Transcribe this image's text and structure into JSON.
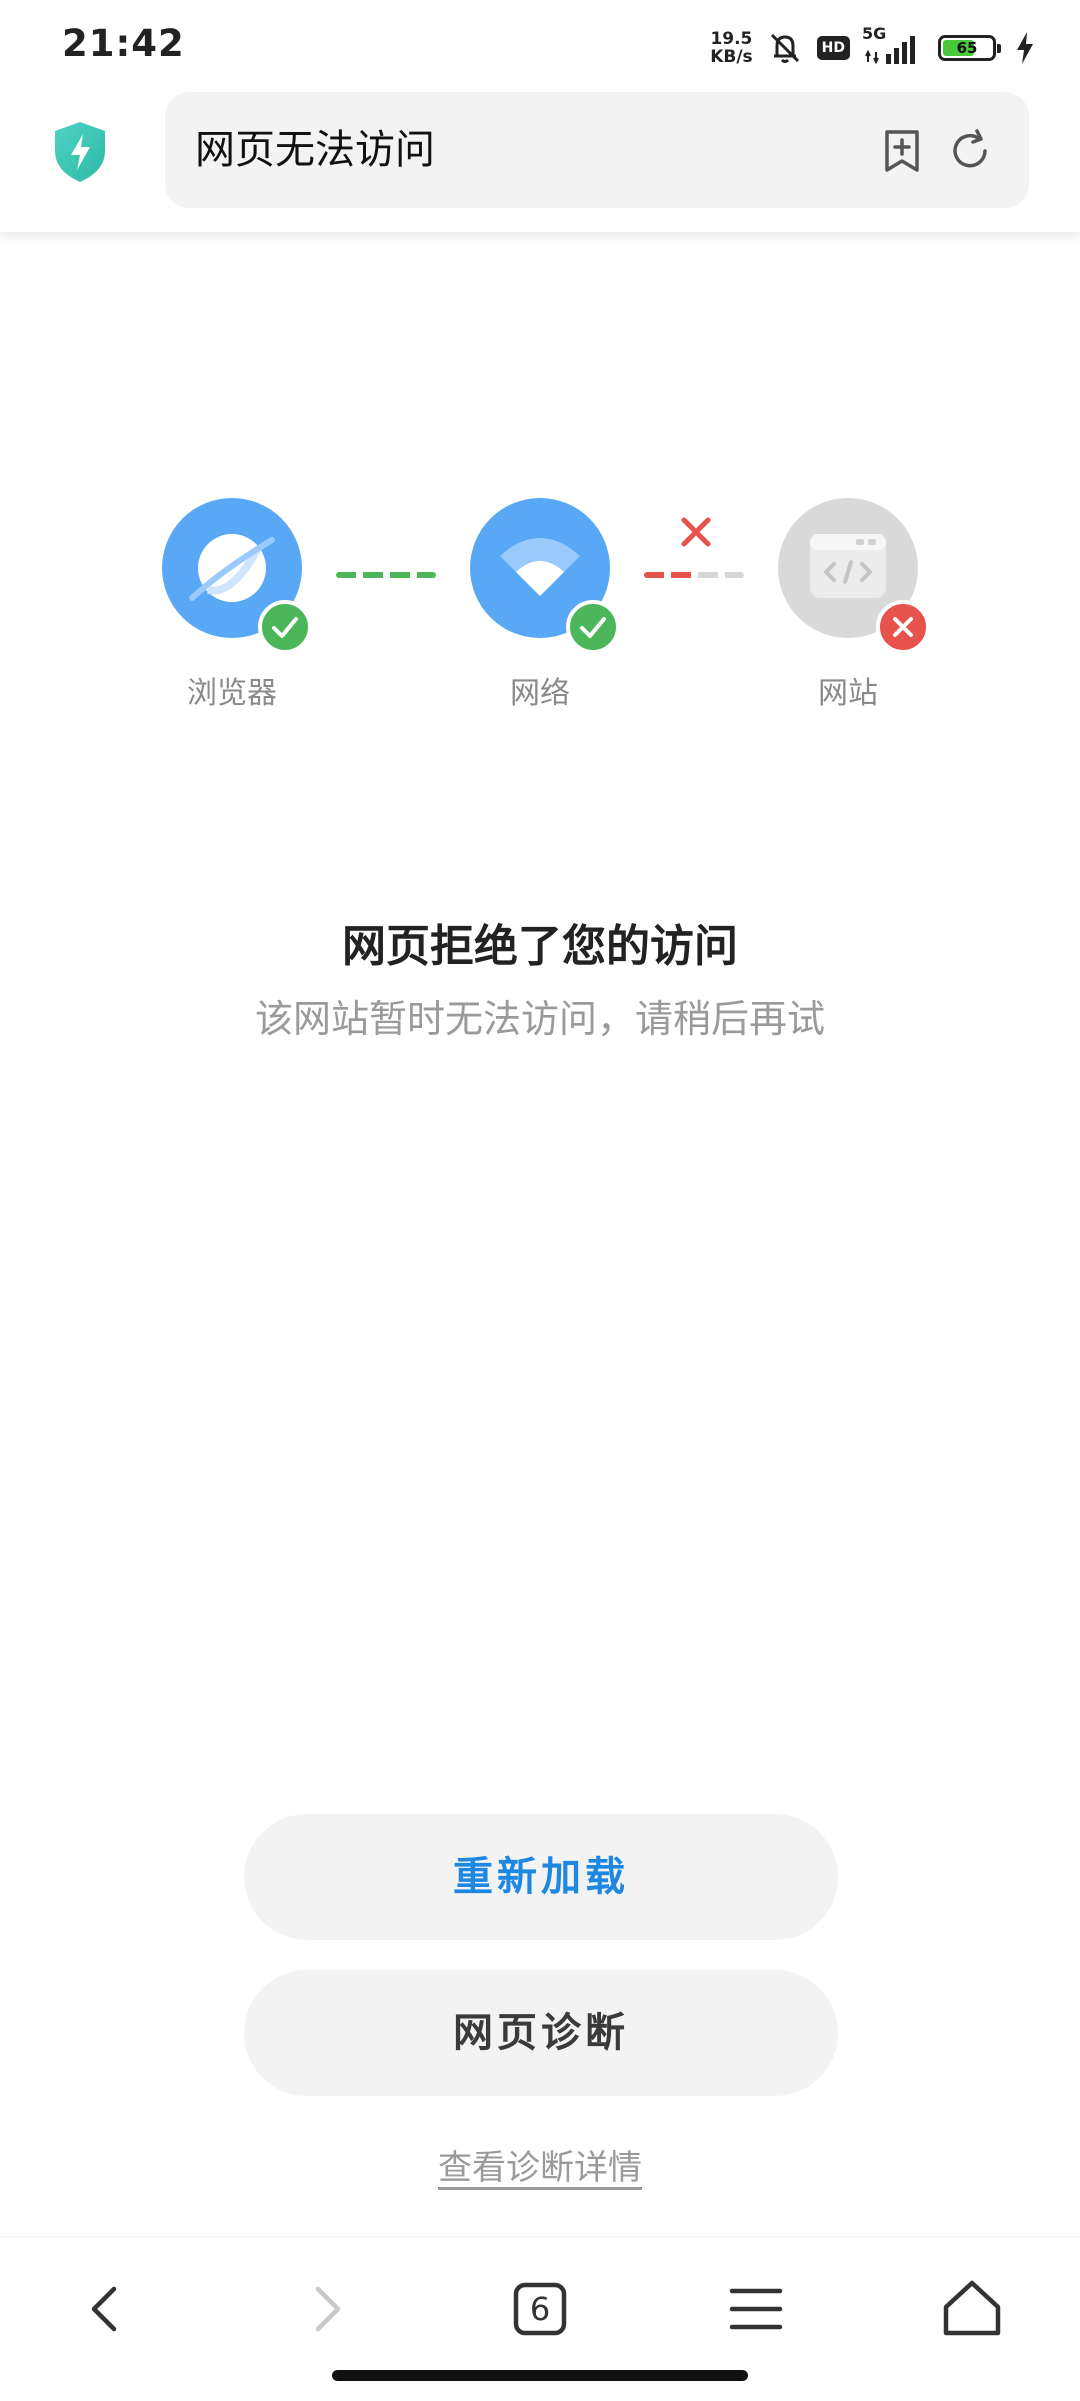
{
  "status_bar": {
    "time": "21:42",
    "net_speed_value": "19.5",
    "net_speed_unit": "KB/s",
    "hd_label": "HD",
    "network_type": "5G",
    "battery_level": "65",
    "icons": [
      "mute-icon",
      "hd-icon",
      "signal-icon",
      "battery-icon",
      "charging-icon"
    ]
  },
  "address_bar": {
    "title": "网页无法访问",
    "icons": [
      "shield-lightning-icon",
      "bookmark-add-icon",
      "refresh-icon"
    ]
  },
  "diagnosis": {
    "nodes": [
      {
        "label": "浏览器",
        "icon": "browser-planet-icon",
        "status": "ok"
      },
      {
        "label": "网络",
        "icon": "wifi-icon",
        "status": "ok"
      },
      {
        "label": "网站",
        "icon": "code-window-icon",
        "status": "error"
      }
    ],
    "colors": {
      "ok": "#4cb65a",
      "error": "#e8524d",
      "node_active": "#58a8f6",
      "node_inactive": "#d9d9d9"
    }
  },
  "error": {
    "title": "网页拒绝了您的访问",
    "subtitle": "该网站暂时无法访问，请稍后再试"
  },
  "actions": {
    "reload_label": "重新加载",
    "diagnose_label": "网页诊断",
    "details_link": "查看诊断详情"
  },
  "bottom_nav": {
    "tab_count": "6",
    "icons": [
      "back-icon",
      "forward-icon",
      "tabs-icon",
      "menu-icon",
      "home-icon"
    ]
  }
}
